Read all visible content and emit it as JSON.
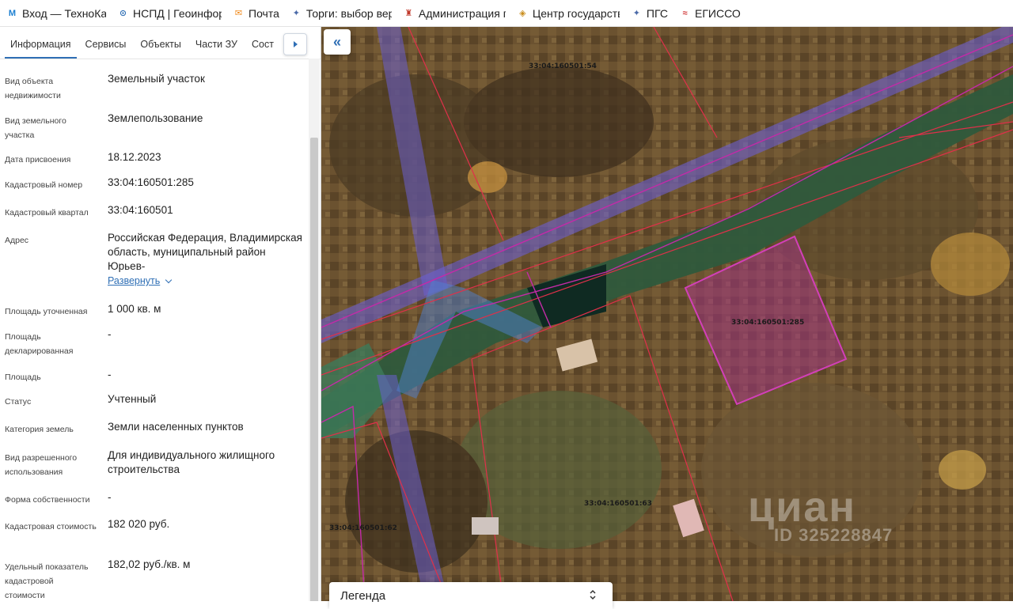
{
  "bookmarks": [
    {
      "icon": "M",
      "label": "Вход — ТехноКад"
    },
    {
      "icon": "⊙",
      "label": "НСПД | Геоинфор"
    },
    {
      "icon": "✉",
      "label": "Почта"
    },
    {
      "icon": "✦",
      "label": "Торги: выбор вер"
    },
    {
      "icon": "♜",
      "label": "Администрация г"
    },
    {
      "icon": "◈",
      "label": "Центр государств"
    },
    {
      "icon": "✦",
      "label": "ПГС"
    },
    {
      "icon": "≈",
      "label": "ЕГИССО"
    }
  ],
  "tabs": [
    {
      "label": "Информация"
    },
    {
      "label": "Сервисы"
    },
    {
      "label": "Объекты"
    },
    {
      "label": "Части ЗУ"
    },
    {
      "label": "Сост"
    }
  ],
  "properties": [
    {
      "label": "Вид объекта недвижимости",
      "value": "Земельный участок"
    },
    {
      "label": "Вид земельного участка",
      "value": "Землепользование"
    },
    {
      "label": "Дата присвоения",
      "value": "18.12.2023"
    },
    {
      "label": "Кадастровый номер",
      "value": "33:04:160501:285"
    },
    {
      "label": "Кадастровый квартал",
      "value": "33:04:160501"
    },
    {
      "label": "Адрес",
      "value": "Российская Федерация, Владимирская область, муниципальный район Юрьев-"
    },
    {
      "label": "Площадь уточненная",
      "value": "1 000 кв. м"
    },
    {
      "label": "Площадь декларированная",
      "value": "-"
    },
    {
      "label": "Площадь",
      "value": "-"
    },
    {
      "label": "Статус",
      "value": "Учтенный"
    },
    {
      "label": "Категория земель",
      "value": "Земли населенных пунктов"
    },
    {
      "label": "Вид разрешенного использования",
      "value": "Для индивидуального жилищного строительства"
    },
    {
      "label": "Форма собственности",
      "value": "-"
    },
    {
      "label": "Кадастровая стоимость",
      "value": "182 020 руб."
    },
    {
      "label": "Удельный показатель кадастровой стоимости",
      "value": "182,02 руб./кв. м"
    }
  ],
  "address_expand": "Развернуть",
  "map": {
    "collapse_icon": "«",
    "parcels": [
      "33:04:160501:54",
      "33:04:160501:285",
      "33:04:160501:63",
      "33:04:160501:62"
    ],
    "watermark": "циан",
    "watermark_id": "ID 325228847",
    "colors": {
      "selected_fill": "#a0357f",
      "boundary": "#e0304a",
      "zone": "#6a5fd0"
    }
  },
  "legend": {
    "title": "Легенда"
  }
}
